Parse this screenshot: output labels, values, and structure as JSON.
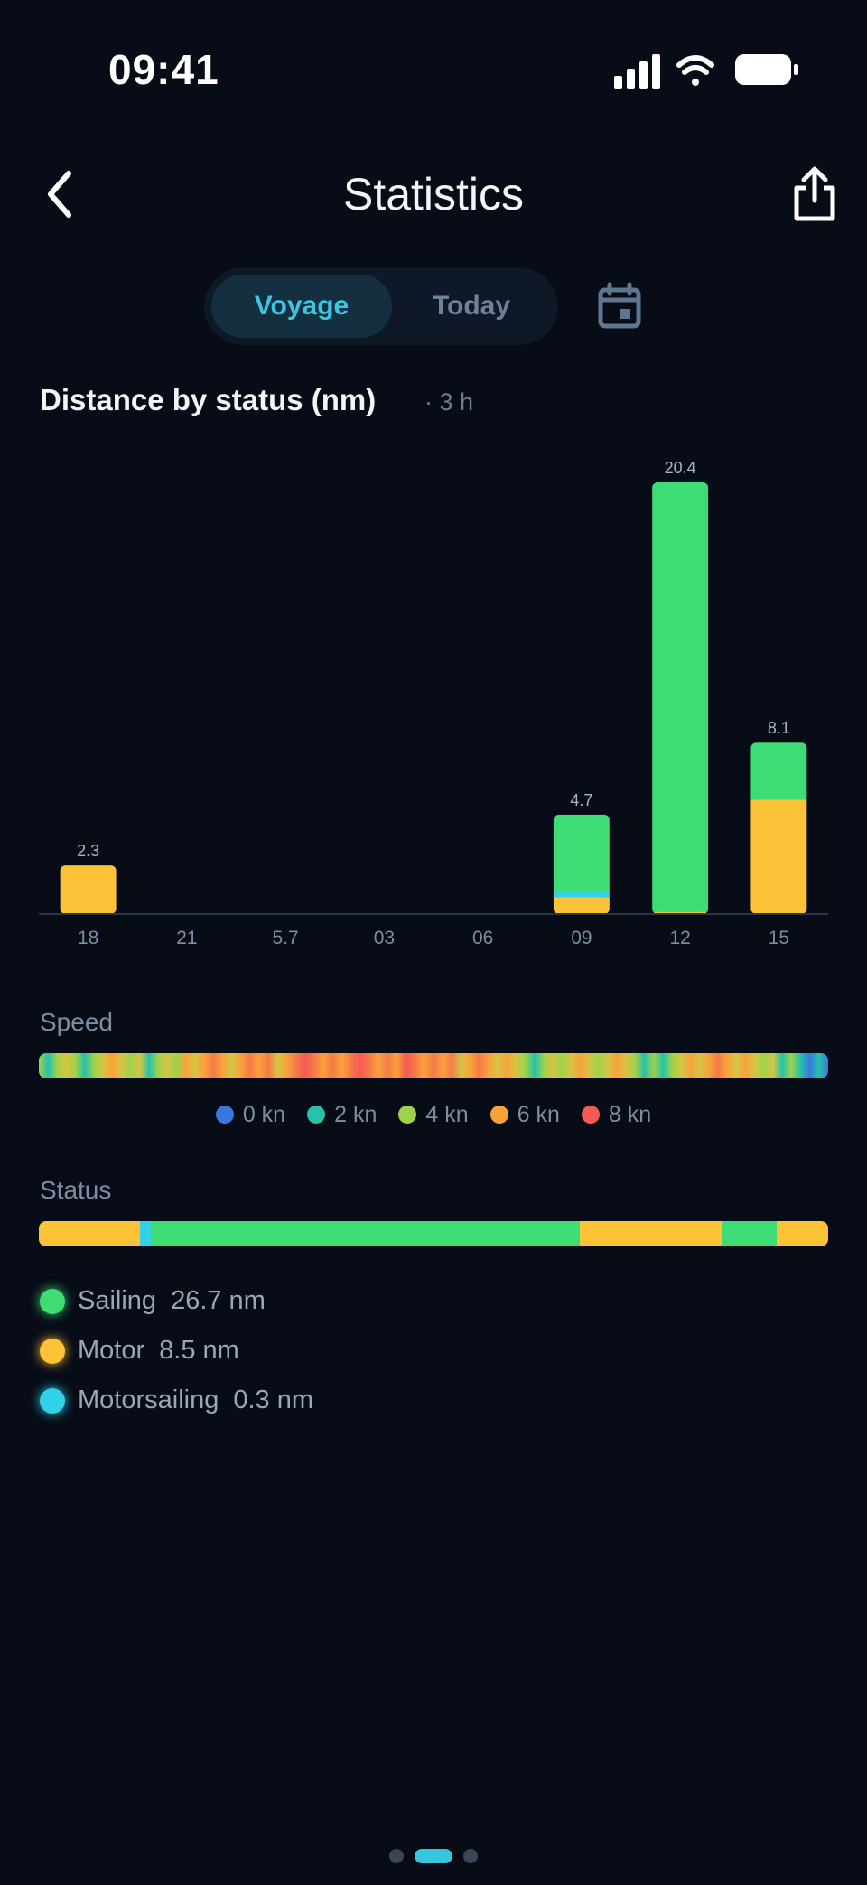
{
  "status_bar": {
    "time": "09:41"
  },
  "header": {
    "title": "Statistics"
  },
  "segments": {
    "voyage": "Voyage",
    "today": "Today"
  },
  "chart": {
    "title": "Distance by status (nm)",
    "subtitle": "· 3 h"
  },
  "colors": {
    "sailing": "#3ddc74",
    "motor": "#fcc337",
    "motorsailing": "#31d1e8",
    "accent": "#3dc6e3",
    "background": "#070c17"
  },
  "chart_data": {
    "type": "bar",
    "stacked": true,
    "title": "Distance by status (nm)",
    "categories": [
      "18",
      "21",
      "5.7",
      "03",
      "06",
      "09",
      "12",
      "15"
    ],
    "series": [
      {
        "name": "Motor",
        "values": [
          2.3,
          0,
          0,
          0,
          0,
          0.8,
          0.1,
          5.4
        ]
      },
      {
        "name": "Motorsailing",
        "values": [
          0,
          0,
          0,
          0,
          0,
          0.3,
          0,
          0
        ]
      },
      {
        "name": "Sailing",
        "values": [
          0,
          0,
          0,
          0,
          0,
          3.6,
          20.3,
          2.7
        ]
      }
    ],
    "totals": [
      2.3,
      0,
      0,
      0,
      0,
      4.7,
      20.4,
      8.1
    ],
    "total_labels": [
      "2.3",
      "",
      "",
      "",
      "",
      "4.7",
      "20.4",
      "8.1"
    ],
    "ylim": [
      0,
      20.4
    ],
    "grid": false
  },
  "speed": {
    "label": "Speed",
    "legend": [
      {
        "label": "0 kn",
        "color": "#3a78dd"
      },
      {
        "label": "2 kn",
        "color": "#26c2aa"
      },
      {
        "label": "4 kn",
        "color": "#9ed24b"
      },
      {
        "label": "6 kn",
        "color": "#f9a23a"
      },
      {
        "label": "8 kn",
        "color": "#f55a55"
      }
    ]
  },
  "status": {
    "label": "Status",
    "timeline": [
      {
        "status": "motor",
        "fraction": 0.128
      },
      {
        "status": "motorsailing",
        "fraction": 0.014
      },
      {
        "status": "sailing",
        "fraction": 0.543
      },
      {
        "status": "motor",
        "fraction": 0.18
      },
      {
        "status": "sailing",
        "fraction": 0.07
      },
      {
        "status": "motor",
        "fraction": 0.065
      }
    ],
    "items": [
      {
        "name": "Sailing",
        "value": "26.7 nm",
        "color": "#3ddc74"
      },
      {
        "name": "Motor",
        "value": "8.5 nm",
        "color": "#fcc337"
      },
      {
        "name": "Motorsailing",
        "value": "0.3 nm",
        "color": "#31d1e8"
      }
    ]
  },
  "pagination": {
    "count": 3,
    "active": 1
  }
}
